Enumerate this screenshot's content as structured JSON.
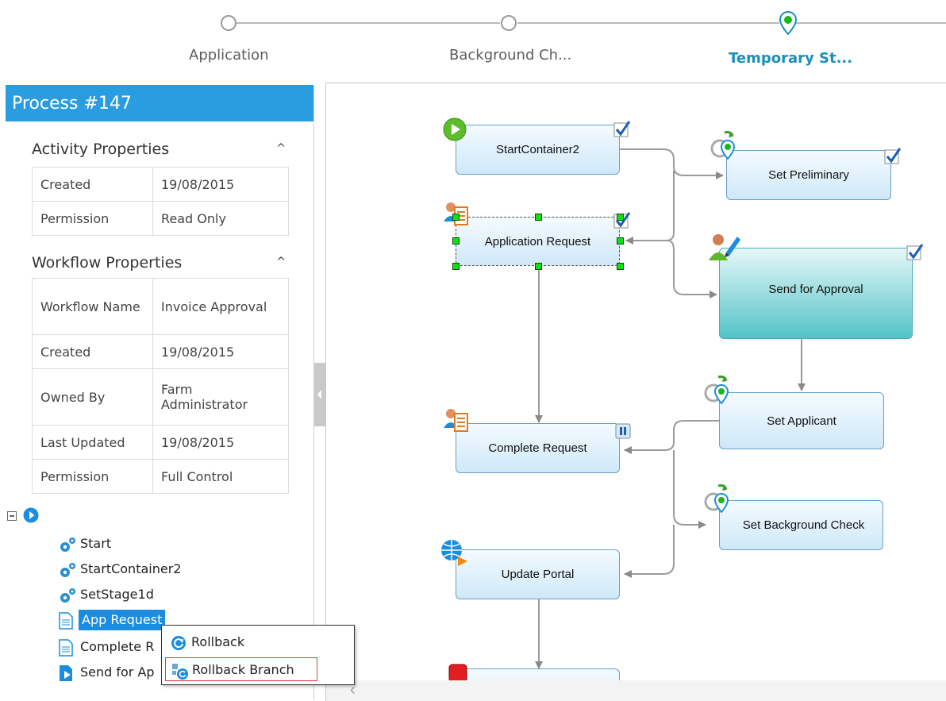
{
  "stages": [
    {
      "label": "Application",
      "state": "done"
    },
    {
      "label": "Background Ch...",
      "state": "done"
    },
    {
      "label": "Temporary St...",
      "state": "current"
    }
  ],
  "panel": {
    "title": "Process #147",
    "activity": {
      "heading": "Activity Properties",
      "rows": [
        {
          "key": "Created",
          "value": "19/08/2015"
        },
        {
          "key": "Permission",
          "value": "Read Only"
        }
      ]
    },
    "workflow": {
      "heading": "Workflow Properties",
      "rows": [
        {
          "key": "Workflow Name",
          "value": "Invoice Approval"
        },
        {
          "key": "Created",
          "value": "19/08/2015"
        },
        {
          "key": "Owned By",
          "value": "Farm Administrator"
        },
        {
          "key": "Last Updated",
          "value": "19/08/2015"
        },
        {
          "key": "Permission",
          "value": "Full Control"
        }
      ]
    },
    "tree": [
      {
        "label": "Start",
        "icon": "gears-icon"
      },
      {
        "label": "StartContainer2",
        "icon": "gears-icon"
      },
      {
        "label": "SetStage1d",
        "icon": "gears-icon"
      },
      {
        "label": "App Request",
        "icon": "document-icon",
        "selected": true
      },
      {
        "label": "Complete R",
        "icon": "document-icon"
      },
      {
        "label": "Send for Ap",
        "icon": "send-document-icon"
      }
    ]
  },
  "context_menu": {
    "items": [
      {
        "label": "Rollback",
        "icon": "rollback-icon"
      },
      {
        "label": "Rollback Branch",
        "icon": "rollback-branch-icon",
        "highlighted": true
      }
    ]
  },
  "canvas": {
    "nodes": [
      {
        "id": "startcontainer2",
        "label": "StartContainer2",
        "icon": "start-play-icon",
        "badge": "checkbox-icon"
      },
      {
        "id": "set-preliminary",
        "label": "Set Preliminary",
        "icon": "location-pin-icon",
        "badge": "checkbox-icon"
      },
      {
        "id": "application-request",
        "label": "Application Request",
        "icon": "user-document-icon",
        "badge": "checkbox-icon",
        "selected": true
      },
      {
        "id": "send-for-approval",
        "label": "Send for Approval",
        "icon": "user-pen-icon",
        "badge": "checkbox-icon"
      },
      {
        "id": "complete-request",
        "label": "Complete Request",
        "icon": "user-document-icon",
        "badge": "pause-icon"
      },
      {
        "id": "set-applicant",
        "label": "Set Applicant",
        "icon": "location-pin-icon"
      },
      {
        "id": "set-background-check",
        "label": "Set Background Check",
        "icon": "location-pin-icon"
      },
      {
        "id": "update-portal",
        "label": "Update Portal",
        "icon": "globe-arrow-icon"
      },
      {
        "id": "end",
        "label": "",
        "icon": "stop-icon"
      }
    ]
  },
  "colors": {
    "accent": "#2a9de0",
    "selection": "#1a8de0",
    "current_stage": "#1a8fb9",
    "handle": "#10e010",
    "highlight_border": "#e0393e"
  }
}
